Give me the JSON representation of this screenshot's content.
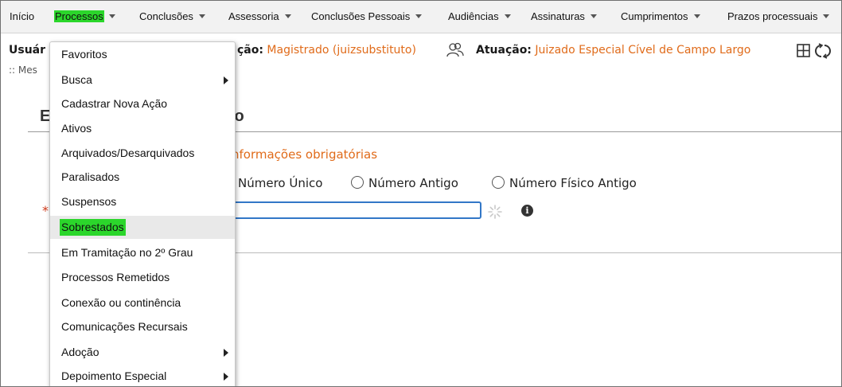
{
  "menu": [
    {
      "label": "Início",
      "has_caret": false
    },
    {
      "label": "Processos",
      "has_caret": true,
      "active": true
    },
    {
      "label": "Conclusões",
      "has_caret": true
    },
    {
      "label": "Assessoria",
      "has_caret": true
    },
    {
      "label": "Conclusões Pessoais",
      "has_caret": true
    },
    {
      "label": "Audiências",
      "has_caret": true
    },
    {
      "label": "Assinaturas",
      "has_caret": true
    },
    {
      "label": "Cumprimentos",
      "has_caret": true
    },
    {
      "label": "Prazos processuais",
      "has_caret": true
    }
  ],
  "user_bar": {
    "user_label": "Usuár",
    "profile_label": "ção:",
    "profile_value": "Magistrado (juizsubstituto)",
    "atuacao_label": "Atuação:",
    "atuacao_value": "Juizado Especial Cível de Campo Largo",
    "crumb": ":: Mes"
  },
  "page": {
    "title_visible": "E",
    "title_tail": "so",
    "required_info": "nformações obrigatórias",
    "radios": [
      "Número Único",
      "Número Antigo",
      "Número Físico Antigo"
    ],
    "required_star": "*",
    "input_value": "",
    "info_icon": "i"
  },
  "dropdown": {
    "items": [
      {
        "label": "Favoritos",
        "submenu": false
      },
      {
        "label": "Busca",
        "submenu": true
      },
      {
        "label": "Cadastrar Nova Ação",
        "submenu": false
      },
      {
        "label": "Ativos",
        "submenu": false
      },
      {
        "label": "Arquivados/Desarquivados",
        "submenu": false
      },
      {
        "label": "Paralisados",
        "submenu": false
      },
      {
        "label": "Suspensos",
        "submenu": false
      },
      {
        "label": "Sobrestados",
        "submenu": false,
        "selected": true
      },
      {
        "label": "Em Tramitação no 2º Grau",
        "submenu": false
      },
      {
        "label": "Processos Remetidos",
        "submenu": false
      },
      {
        "label": "Conexão ou continência",
        "submenu": false
      },
      {
        "label": "Comunicações Recursais",
        "submenu": false
      },
      {
        "label": "Adoção",
        "submenu": true
      },
      {
        "label": "Depoimento Especial",
        "submenu": true
      }
    ]
  },
  "colors": {
    "highlight": "#2bd62b",
    "accent_orange": "#e06b1a",
    "input_border": "#3277c7"
  },
  "icons": [
    "users-icon",
    "grid-icon",
    "refresh-icon",
    "spinner-icon",
    "info-icon",
    "chevron-right-icon",
    "caret-down-icon"
  ]
}
